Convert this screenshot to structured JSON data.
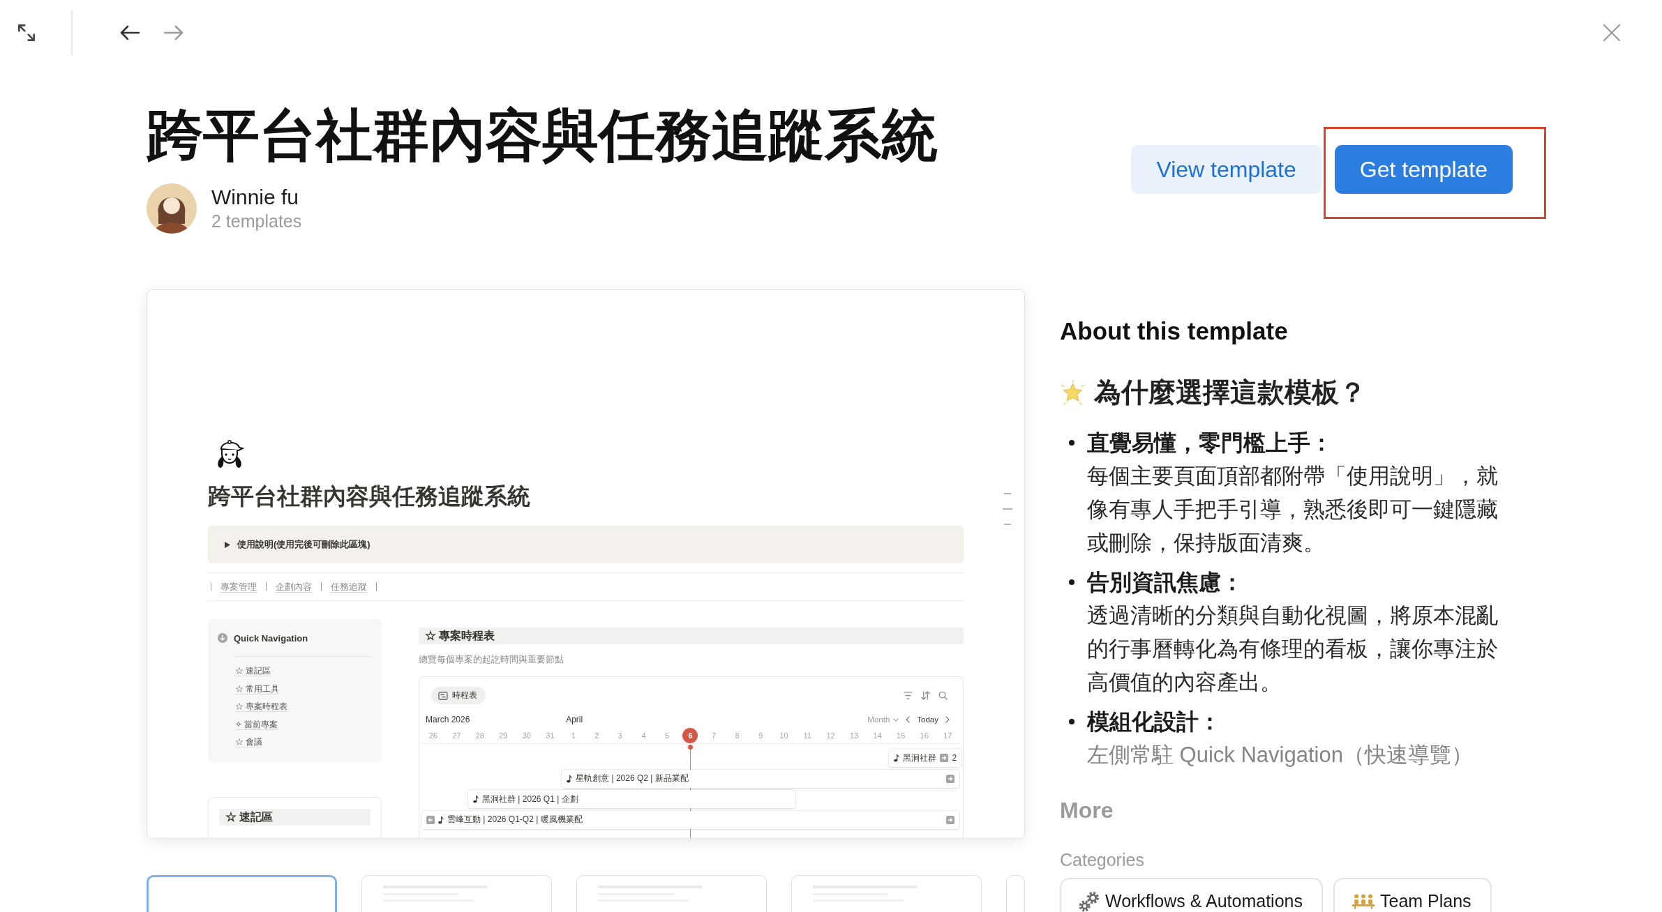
{
  "toolbar": {
    "back": {
      "disabled": false
    },
    "forward": {
      "disabled": true
    }
  },
  "header": {
    "title": "跨平台社群內容與任務追蹤系統",
    "author": {
      "name": "Winnie fu",
      "templates": "2 templates"
    },
    "buttons": [
      {
        "label": "View template",
        "kind": "secondary",
        "highlighted": false
      },
      {
        "label": "Get template",
        "kind": "primary",
        "highlighted": true
      }
    ]
  },
  "preview": {
    "page": {
      "title": "跨平台社群內容與任務追蹤系統",
      "callout": {
        "label": "使用說明(使用完後可刪除此區塊)",
        "expanded": false
      },
      "links": [
        "專案管理",
        "企劃內容",
        "任務追蹤"
      ],
      "quick_navigation": {
        "title": "Quick Navigation",
        "items": [
          "☆ 速記區",
          "☆ 常用工具",
          "☆ 專案時程表",
          "✧ 當前專案",
          "☆ 會議"
        ]
      },
      "notes": {
        "title": "☆ 速記區"
      },
      "timeline": {
        "title": "☆ 專案時程表",
        "description": "總覽每個專案的起訖時間與重要節點",
        "view_tab": "時程表",
        "months": [
          "March 2026",
          "April"
        ],
        "scale": "Month",
        "today_button": "Today",
        "dates": [
          {
            "label": "26",
            "today": false
          },
          {
            "label": "27",
            "today": false
          },
          {
            "label": "28",
            "today": false
          },
          {
            "label": "29",
            "today": false
          },
          {
            "label": "30",
            "today": false
          },
          {
            "label": "31",
            "today": false
          },
          {
            "label": "1",
            "today": false
          },
          {
            "label": "2",
            "today": false
          },
          {
            "label": "3",
            "today": false
          },
          {
            "label": "4",
            "today": false
          },
          {
            "label": "5",
            "today": false
          },
          {
            "label": "6",
            "today": true
          },
          {
            "label": "7",
            "today": false
          },
          {
            "label": "8",
            "today": false
          },
          {
            "label": "9",
            "today": false
          },
          {
            "label": "10",
            "today": false
          },
          {
            "label": "11",
            "today": false
          },
          {
            "label": "12",
            "today": false
          },
          {
            "label": "13",
            "today": false
          },
          {
            "label": "14",
            "today": false
          },
          {
            "label": "15",
            "today": false
          },
          {
            "label": "16",
            "today": false
          },
          {
            "label": "17",
            "today": false
          }
        ],
        "bars": [
          {
            "label": "黑洞社群",
            "tail": "2",
            "continues_before": false,
            "continues_after": true
          },
          {
            "label": "星軌創意 | 2026 Q2 | 新品業配",
            "continues_before": false,
            "continues_after": true
          },
          {
            "label": "黑洞社群 | 2026 Q1 | 企劃",
            "continues_before": false,
            "continues_after": false
          },
          {
            "label": "雲峰互動 | 2026 Q1-Q2 | 暖風機業配",
            "continues_before": true,
            "continues_after": true
          }
        ]
      }
    },
    "thumbnails": [
      {
        "selected": true
      },
      {
        "selected": false
      },
      {
        "selected": false
      },
      {
        "selected": false
      },
      {
        "selected": false
      }
    ]
  },
  "about": {
    "heading": "About this template",
    "subheading": "為什麼選擇這款模板？",
    "expanded": false,
    "points": [
      {
        "title": "直覺易懂，零門檻上手：",
        "body": "每個主要頁面頂部都附帶「使用說明」，就像有專人手把手引導，熟悉後即可一鍵隱藏或刪除，保持版面清爽。"
      },
      {
        "title": "告別資訊焦慮：",
        "body": "透過清晰的分類與自動化視圖，將原本混亂的行事曆轉化為有條理的看板，讓你專注於高價值的內容產出。"
      },
      {
        "title": "模組化設計：",
        "body": "左側常駐 Quick Navigation（快速導覽）"
      }
    ],
    "more": "More"
  },
  "categories": {
    "label": "Categories",
    "items": [
      {
        "label": "Workflows & Automations",
        "kind": "gears"
      },
      {
        "label": "Team Plans",
        "kind": "team"
      }
    ]
  }
}
